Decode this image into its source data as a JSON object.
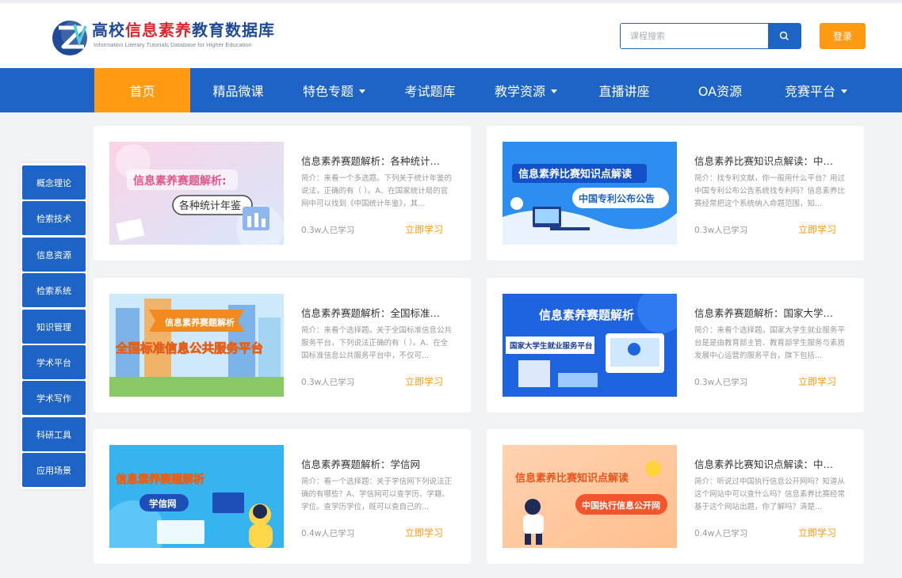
{
  "brand": {
    "title_part1": "高校",
    "title_part2": "信息素养",
    "title_part3": "教育数据库",
    "subtitle": "Information Literary Tutorials Database for Higher Education",
    "colors": {
      "primary": "#1e63c6",
      "accent": "#ff9a12",
      "title_blue": "#1e4a99",
      "title_red": "#e0262d"
    }
  },
  "header": {
    "search_placeholder": "课程搜索",
    "search_value": "",
    "search_icon": "search-icon",
    "login_label": "登录"
  },
  "nav": {
    "items": [
      {
        "label": "首页",
        "active": true,
        "dropdown": false
      },
      {
        "label": "精品微课",
        "active": false,
        "dropdown": false
      },
      {
        "label": "特色专题",
        "active": false,
        "dropdown": true
      },
      {
        "label": "考试题库",
        "active": false,
        "dropdown": false
      },
      {
        "label": "教学资源",
        "active": false,
        "dropdown": true
      },
      {
        "label": "直播讲座",
        "active": false,
        "dropdown": false
      },
      {
        "label": "OA资源",
        "active": false,
        "dropdown": false
      },
      {
        "label": "竞赛平台",
        "active": false,
        "dropdown": true
      }
    ]
  },
  "sidebar": {
    "items": [
      {
        "label": "概念理论"
      },
      {
        "label": "检索技术"
      },
      {
        "label": "信息资源"
      },
      {
        "label": "检索系统"
      },
      {
        "label": "知识管理"
      },
      {
        "label": "学术平台"
      },
      {
        "label": "学术写作"
      },
      {
        "label": "科研工具"
      },
      {
        "label": "应用场景"
      }
    ]
  },
  "cards": [
    {
      "title": "信息素养赛题解析：各种统计年鉴",
      "desc": "简介：来看一个多选题。下列关于统计年鉴的说法，正确的有（ ）。A、在国家统计局的官网中可以找到《中国统计年鉴》，其...",
      "count": "0.3w人已学习",
      "link": "立即学习",
      "thumb": {
        "line1": "信息素养赛题解析:",
        "line2": "各种统计年鉴"
      }
    },
    {
      "title": "信息素养比赛知识点解读：中国专利公布公告",
      "desc": "简介：找专利文献，你一般用什么平台？用过中国专利公布公告系统找专利吗？信息素养比赛经常把这个系统纳入命题范围，知...",
      "count": "0.3w人已学习",
      "link": "立即学习",
      "thumb": {
        "line1": "信息素养比赛知识点解读",
        "line2": "中国专利公布公告"
      }
    },
    {
      "title": "信息素养赛题解析：全国标准信息公共服务平台",
      "desc": "简介：来看个选择题。关于全国标准信息公共服务平台，下列说法正确的有（ ）。A、在全国标准信息公共服务平台中，不仅可...",
      "count": "0.3w人已学习",
      "link": "立即学习",
      "thumb": {
        "line1": "信息素养赛题解析",
        "line2": "全国标准信息公共服务平台"
      }
    },
    {
      "title": "信息素养赛题解析：国家大学生就业服务平台",
      "desc": "简介：来看个选择题。国家大学生就业服务平台是是由教育部主管、教育部学生服务与素质发展中心运营的服务平台，旗下包括...",
      "count": "0.3w人已学习",
      "link": "立即学习",
      "thumb": {
        "line1": "信息素养赛题解析",
        "line2": "国家大学生就业服务平台"
      }
    },
    {
      "title": "信息素养赛题解析：学信网",
      "desc": "简介：看一个选择题：关于学信网下列说法正确的有哪些？A、学信网可以查学历、学籍、学位。查学历学位，既可以查自己的...",
      "count": "0.4w人已学习",
      "link": "立即学习",
      "thumb": {
        "line1": "信息素养赛题解析",
        "line2": "学信网"
      }
    },
    {
      "title": "信息素养比赛知识点解读：中国执行信息公开网",
      "desc": "简介：听说过中国执行信息公开网吗？知道从这个网站中可以查什么吗？信息素养比赛经常基于这个网站出题，你了解吗？清楚...",
      "count": "0.4w人已学习",
      "link": "立即学习",
      "thumb": {
        "line1": "信息素养比赛知识点解读",
        "line2": "中国执行信息公开网"
      }
    }
  ]
}
